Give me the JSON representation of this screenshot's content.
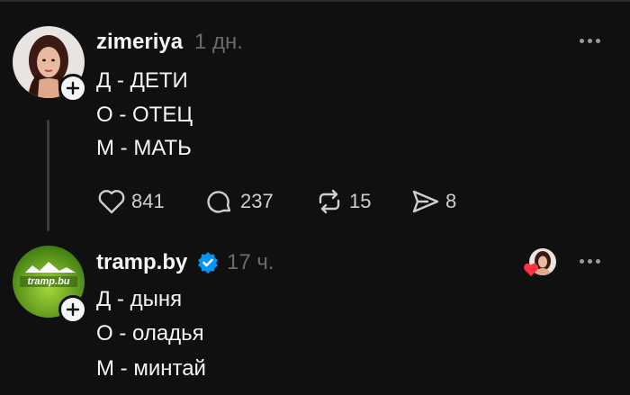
{
  "posts": [
    {
      "username": "zimeriya",
      "time": "1 дн.",
      "lines": [
        "Д - ДЕТИ",
        "О - ОТЕЦ",
        "М - МАТЬ"
      ],
      "actions": {
        "likes": "841",
        "comments": "237",
        "reposts": "15",
        "shares": "8"
      }
    },
    {
      "username": "tramp.by",
      "time": "17 ч.",
      "verified": true,
      "avatar_text": "tramp.bu",
      "lines": [
        "Д - дыня",
        "О - оладья",
        "М - минтай"
      ]
    }
  ],
  "colors": {
    "background": "#101010",
    "text": "#f3f5f7",
    "muted": "#6b6b6b",
    "verified": "#0095f6",
    "heart": "#ff3040"
  }
}
